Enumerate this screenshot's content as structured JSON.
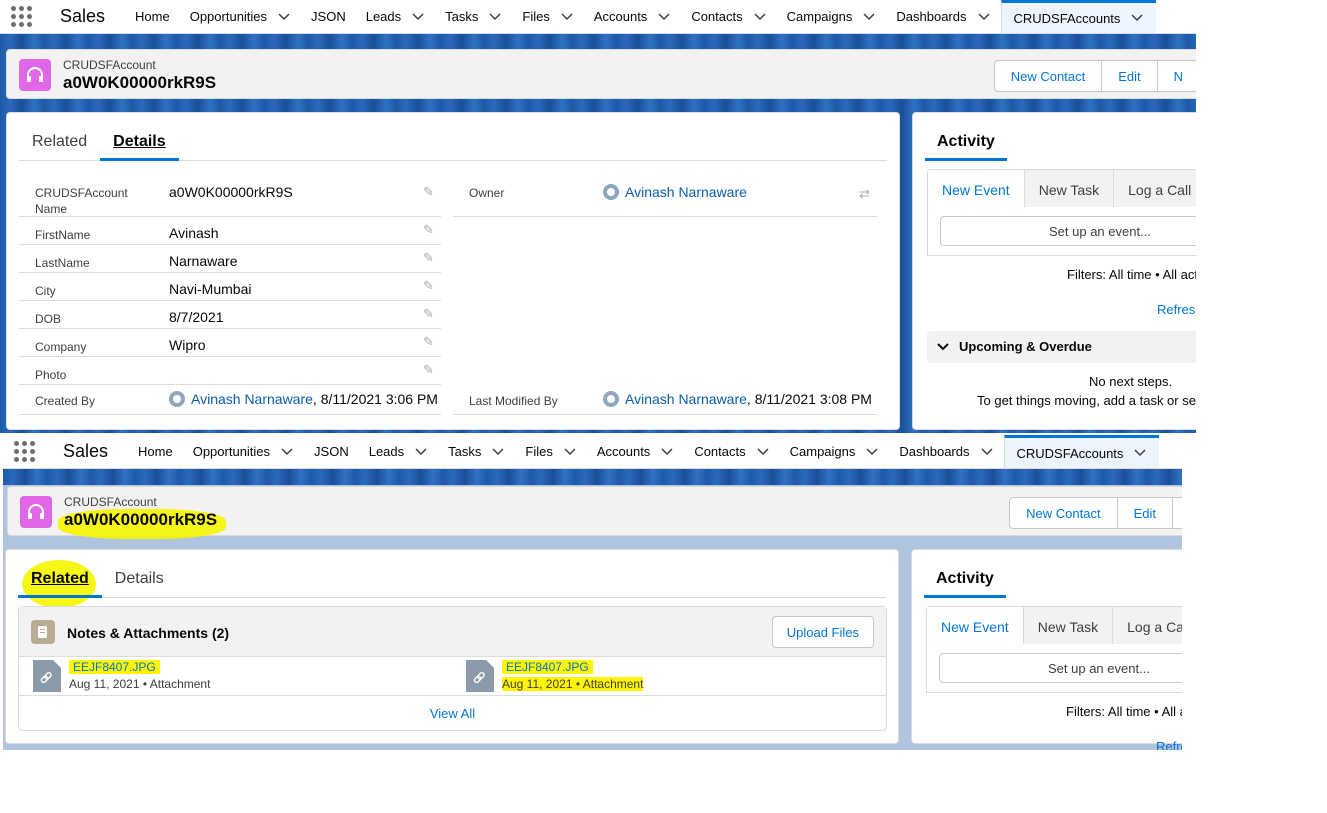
{
  "nav": {
    "app_name": "Sales",
    "items": [
      {
        "label": "Home",
        "has_menu": false
      },
      {
        "label": "Opportunities",
        "has_menu": true
      },
      {
        "label": "JSON",
        "has_menu": false
      },
      {
        "label": "Leads",
        "has_menu": true
      },
      {
        "label": "Tasks",
        "has_menu": true
      },
      {
        "label": "Files",
        "has_menu": true
      },
      {
        "label": "Accounts",
        "has_menu": true
      },
      {
        "label": "Contacts",
        "has_menu": true
      },
      {
        "label": "Campaigns",
        "has_menu": true
      },
      {
        "label": "Dashboards",
        "has_menu": true
      },
      {
        "label": "CRUDSFAccounts",
        "has_menu": true,
        "active": true
      }
    ]
  },
  "header": {
    "object_label": "CRUDSFAccount",
    "record_name": "a0W0K00000rkR9S",
    "buttons": [
      "New Contact",
      "Edit",
      "N"
    ]
  },
  "details": {
    "tabs": [
      "Related",
      "Details"
    ],
    "active_tab_top": "Details",
    "fields": [
      {
        "label": "CRUDSFAccount Name",
        "value": "a0W0K00000rkR9S"
      },
      {
        "label": "FirstName",
        "value": "Avinash"
      },
      {
        "label": "LastName",
        "value": "Narnaware"
      },
      {
        "label": "City",
        "value": "Navi-Mumbai"
      },
      {
        "label": "DOB",
        "value": "8/7/2021"
      },
      {
        "label": "Company",
        "value": "Wipro"
      },
      {
        "label": "Photo",
        "value": ""
      }
    ],
    "owner_label": "Owner",
    "owner_value": "Avinash Narnaware",
    "created_by_label": "Created By",
    "created_by_user": "Avinash Narnaware",
    "created_by_date": ", 8/11/2021 3:06 PM",
    "modified_by_label": "Last Modified By",
    "modified_by_user": "Avinash Narnaware",
    "modified_by_date": ", 8/11/2021 3:08 PM"
  },
  "activity": {
    "title": "Activity",
    "tabs": [
      "New Event",
      "New Task",
      "Log a Call"
    ],
    "setup_placeholder": "Set up an event...",
    "filters": "Filters: All time • All act",
    "filters2": "Filters: All time • All a",
    "refresh": "Refresh",
    "refresh2": "Refre",
    "upcoming": "Upcoming & Overdue",
    "no_steps": "No next steps.",
    "to_move": "To get things moving, add a task or se"
  },
  "header2": {
    "buttons": [
      "New Contact",
      "Edit"
    ]
  },
  "related": {
    "notes_title": "Notes & Attachments (2)",
    "upload_label": "Upload Files",
    "files": [
      {
        "name": "EEJF8407.JPG",
        "date": "Aug 11, 2021",
        "type": "Attachment"
      },
      {
        "name": "EEJF8407.JPG",
        "date": "Aug 11, 2021",
        "type": "Attachment"
      }
    ],
    "view_all": "View All"
  },
  "colors": {
    "brand_blue": "#0176d3",
    "highlight": "#fff500",
    "record_icon": "#e067e6"
  }
}
